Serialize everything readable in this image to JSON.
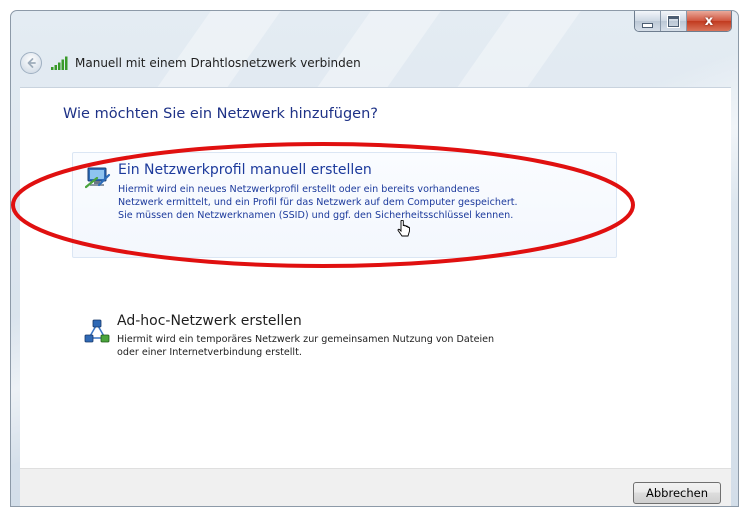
{
  "window": {
    "title": "Manuell mit einem Drahtlosnetzwerk verbinden",
    "caption_buttons": {
      "minimize_icon": "minimize-icon",
      "maximize_icon": "maximize-icon",
      "close_icon": "close-icon",
      "close_glyph": "x"
    }
  },
  "nav": {
    "back_icon": "back-arrow-icon",
    "wifi_icon": "wireless-signal-icon"
  },
  "main": {
    "heading": "Wie möchten Sie ein Netzwerk hinzufügen?",
    "options": [
      {
        "title": "Ein Netzwerkprofil manuell erstellen",
        "description_lines": [
          "Hiermit wird ein neues Netzwerkprofil erstellt oder ein bereits vorhandenes",
          "Netzwerk ermittelt, und ein Profil für das Netzwerk auf dem Computer gespeichert.",
          "Sie müssen den Netzwerknamen (SSID) und ggf. den Sicherheitsschlüssel kennen."
        ],
        "icon": "network-profile-icon",
        "highlighted": true
      },
      {
        "title": "Ad-hoc-Netzwerk erstellen",
        "description_lines": [
          "Hiermit wird ein temporäres Netzwerk zur gemeinsamen Nutzung von Dateien",
          "oder einer Internetverbindung erstellt."
        ],
        "icon": "adhoc-network-icon",
        "highlighted": false
      }
    ]
  },
  "footer": {
    "cancel_label": "Abbrechen"
  },
  "colors": {
    "heading": "#1e3287",
    "option_link": "#1c3a9c",
    "annotation_ellipse": "#e01010",
    "close_button": "#c8432a"
  }
}
